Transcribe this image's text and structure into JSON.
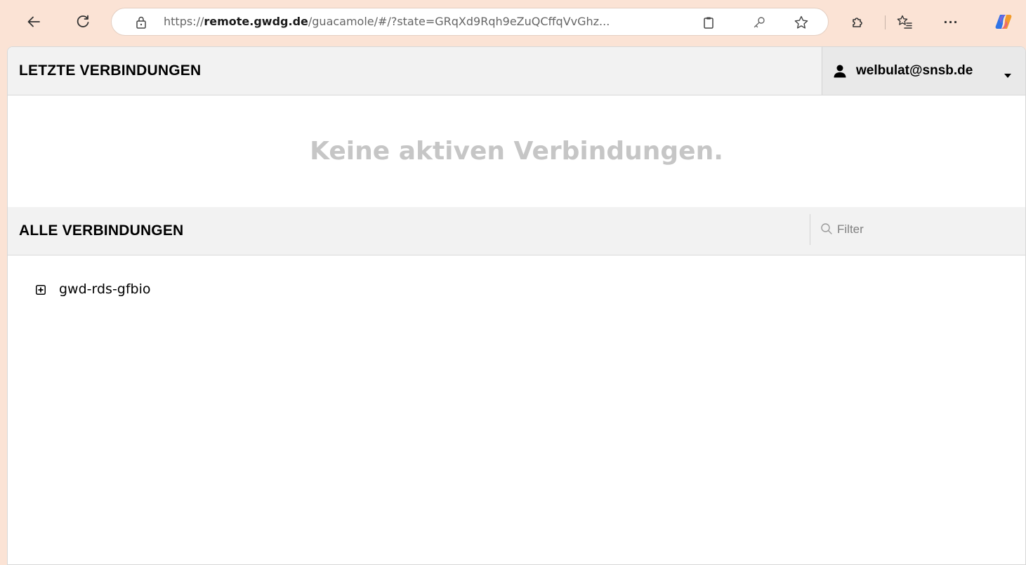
{
  "browser": {
    "url": {
      "scheme": "https://",
      "domain": "remote.gwdg.de",
      "path": "/guacamole/#/?state=GRqXd9Rqh9eZuQCffqVvGhz..."
    },
    "icons": {
      "back": "arrow-left-icon",
      "reload": "reload-icon",
      "site_info": "lock-icon",
      "clipboard": "clipboard-icon",
      "password": "key-icon",
      "favorite": "star-icon",
      "extensions": "puzzle-icon",
      "favorites_list": "favorites-list-icon",
      "more": "more-icon",
      "copilot": "copilot-icon"
    },
    "more_label": "···"
  },
  "recent": {
    "title": "LETZTE VERBINDUNGEN",
    "empty_message": "Keine aktiven Verbindungen."
  },
  "user": {
    "name": "welbulat@snsb.de"
  },
  "all": {
    "title": "ALLE VERBINDUNGEN",
    "filter_placeholder": "Filter",
    "filter_value": "",
    "connections": [
      {
        "name": "gwd-rds-gfbio",
        "expanded": false
      }
    ]
  },
  "colors": {
    "browser_chrome": "#fbe3d5",
    "header_bg": "#f2f2f2",
    "user_menu_bg": "#e9e9e9",
    "empty_text": "#c6c6c6",
    "copilot_blue": "#2f74e6",
    "copilot_orange": "#f29b2b"
  }
}
